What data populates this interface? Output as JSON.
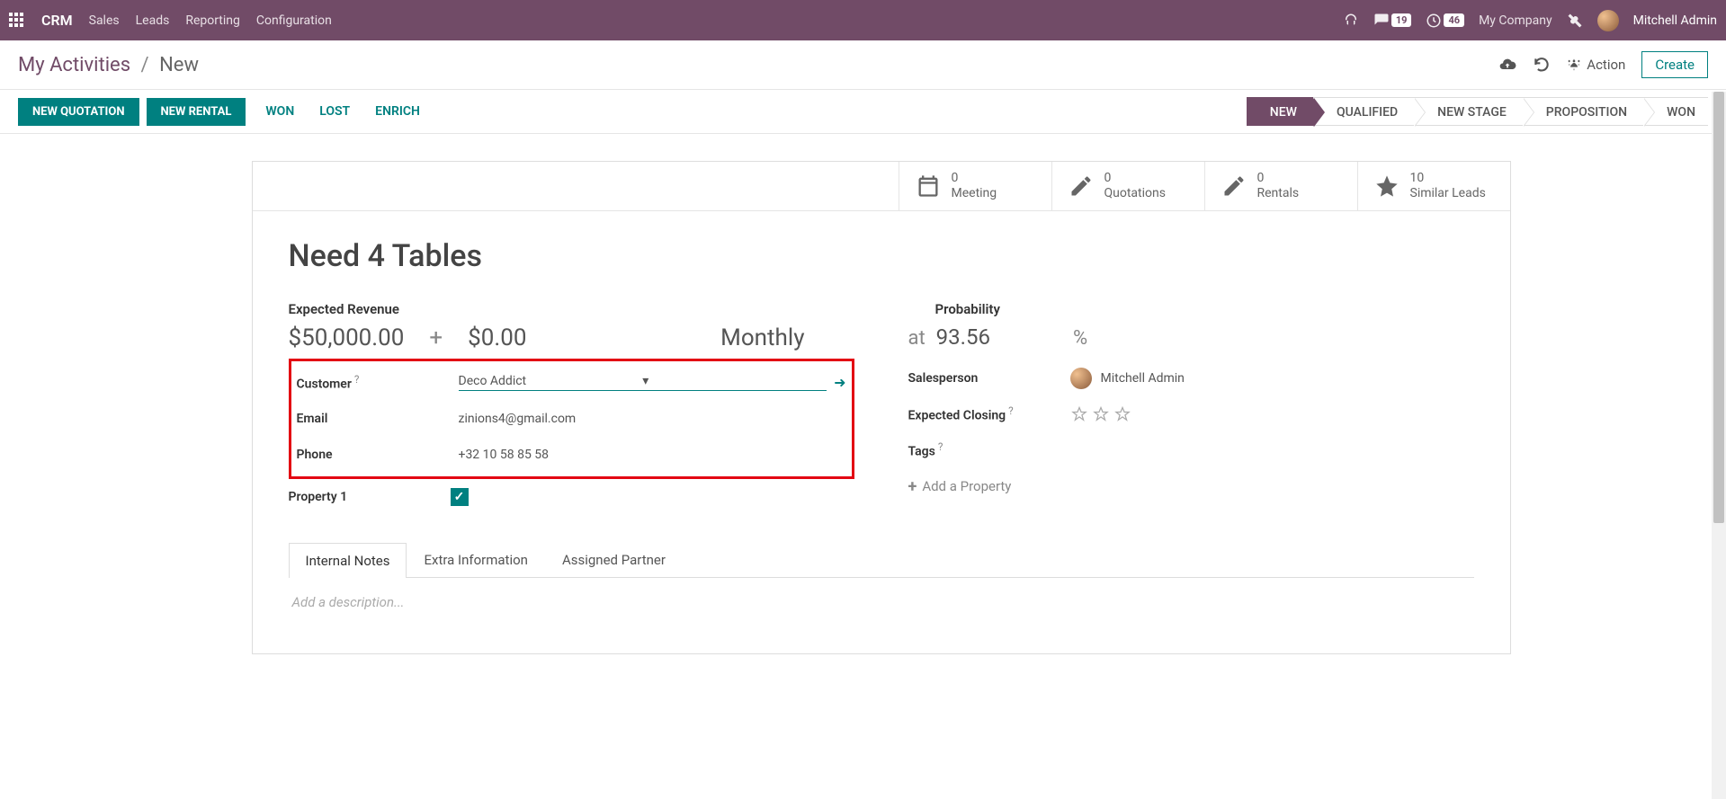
{
  "navbar": {
    "brand": "CRM",
    "items": [
      "Sales",
      "Leads",
      "Reporting",
      "Configuration"
    ],
    "chat_badge": "19",
    "clock_badge": "46",
    "company": "My Company",
    "user": "Mitchell Admin"
  },
  "breadcrumb": {
    "root": "My Activities",
    "current": "New",
    "action_label": "Action",
    "create_label": "Create"
  },
  "buttons": {
    "new_quotation": "NEW QUOTATION",
    "new_rental": "NEW RENTAL",
    "won": "WON",
    "lost": "LOST",
    "enrich": "ENRICH"
  },
  "stages": [
    "NEW",
    "QUALIFIED",
    "NEW STAGE",
    "PROPOSITION",
    "WON"
  ],
  "active_stage": "NEW",
  "stats": {
    "meeting": {
      "count": "0",
      "label": "Meeting"
    },
    "quotations": {
      "count": "0",
      "label": "Quotations"
    },
    "rentals": {
      "count": "0",
      "label": "Rentals"
    },
    "similar": {
      "count": "10",
      "label": "Similar Leads"
    }
  },
  "form": {
    "title": "Need 4 Tables",
    "expected_revenue_label": "Expected Revenue",
    "revenue": "$50,000.00",
    "plus": "+",
    "revenue2": "$0.00",
    "period": "Monthly",
    "probability_label": "Probability",
    "probability_at": "at",
    "probability_value": "93.56",
    "probability_pct": "%",
    "customer_label": "Customer",
    "customer_value": "Deco Addict",
    "email_label": "Email",
    "email_value": "zinions4@gmail.com",
    "phone_label": "Phone",
    "phone_value": "+32 10 58 85 58",
    "property1_label": "Property 1",
    "salesperson_label": "Salesperson",
    "salesperson_value": "Mitchell Admin",
    "expected_closing_label": "Expected Closing",
    "tags_label": "Tags",
    "add_property": "Add a Property"
  },
  "tabs": [
    "Internal Notes",
    "Extra Information",
    "Assigned Partner"
  ],
  "active_tab": "Internal Notes",
  "description_placeholder": "Add a description..."
}
